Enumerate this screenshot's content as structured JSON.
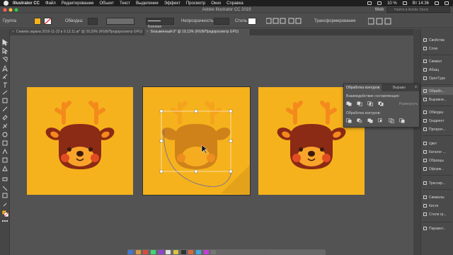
{
  "menubar": {
    "app": "Illustrator CC",
    "items": [
      "Файл",
      "Редактирование",
      "Объект",
      "Текст",
      "Выделение",
      "Эффект",
      "Просмотр",
      "Окно",
      "Справка"
    ],
    "battery": "10 %",
    "clock": "Вт 14:36"
  },
  "titlebar": {
    "title": "Adobe Illustrator CC 2019",
    "workspace": "Web",
    "search_placeholder": "Найти в Adobe Stock"
  },
  "control": {
    "selection_label": "Группа",
    "stroke_label": "Обводка:",
    "stroke_style": "Базовая",
    "opacity_label": "Непрозрачность:",
    "style_label": "Стиль:",
    "transform_label": "Трансформирование"
  },
  "tabs": [
    {
      "label": "Снимок экрана 2019-11-23 в 9.13.11.ai* @ 29,39% (RGB/Предпросмотр GPU)",
      "active": false
    },
    {
      "label": "Безымянный-3* @ 19,13% (RGB/Предпросмотр GPU)",
      "active": true
    }
  ],
  "panels": {
    "items": [
      {
        "label": "Свойства"
      },
      {
        "label": "Слои"
      },
      {
        "label": "Символ"
      },
      {
        "label": "Абзац"
      },
      {
        "label": "OpenType"
      },
      {
        "label": "Обрабо..."
      },
      {
        "label": "Выравни..."
      },
      {
        "label": "Обводка"
      },
      {
        "label": "Градиент"
      },
      {
        "label": "Прозрач..."
      },
      {
        "label": "Цвет"
      },
      {
        "label": "Каталог ..."
      },
      {
        "label": "Образцы"
      },
      {
        "label": "Оформ..."
      },
      {
        "label": "Трассир..."
      },
      {
        "label": "Символы"
      },
      {
        "label": "Кисти"
      },
      {
        "label": "Стили гр..."
      },
      {
        "label": "Парамет..."
      }
    ]
  },
  "pathfinder": {
    "tab_active": "Обработка контуров",
    "tab_other": "Выравн",
    "shape_modes_label": "Взаимодействие составляющих:",
    "expand_label": "Развернуть",
    "pathfinders_label": "Обработка контуров:"
  },
  "colors": {
    "artboard": "#f5b21c",
    "antler": "#f48a1c",
    "head": "#8b2a15",
    "face": "#f8a32a",
    "cheek": "#e24c23",
    "dark": "#3a1a0e"
  }
}
